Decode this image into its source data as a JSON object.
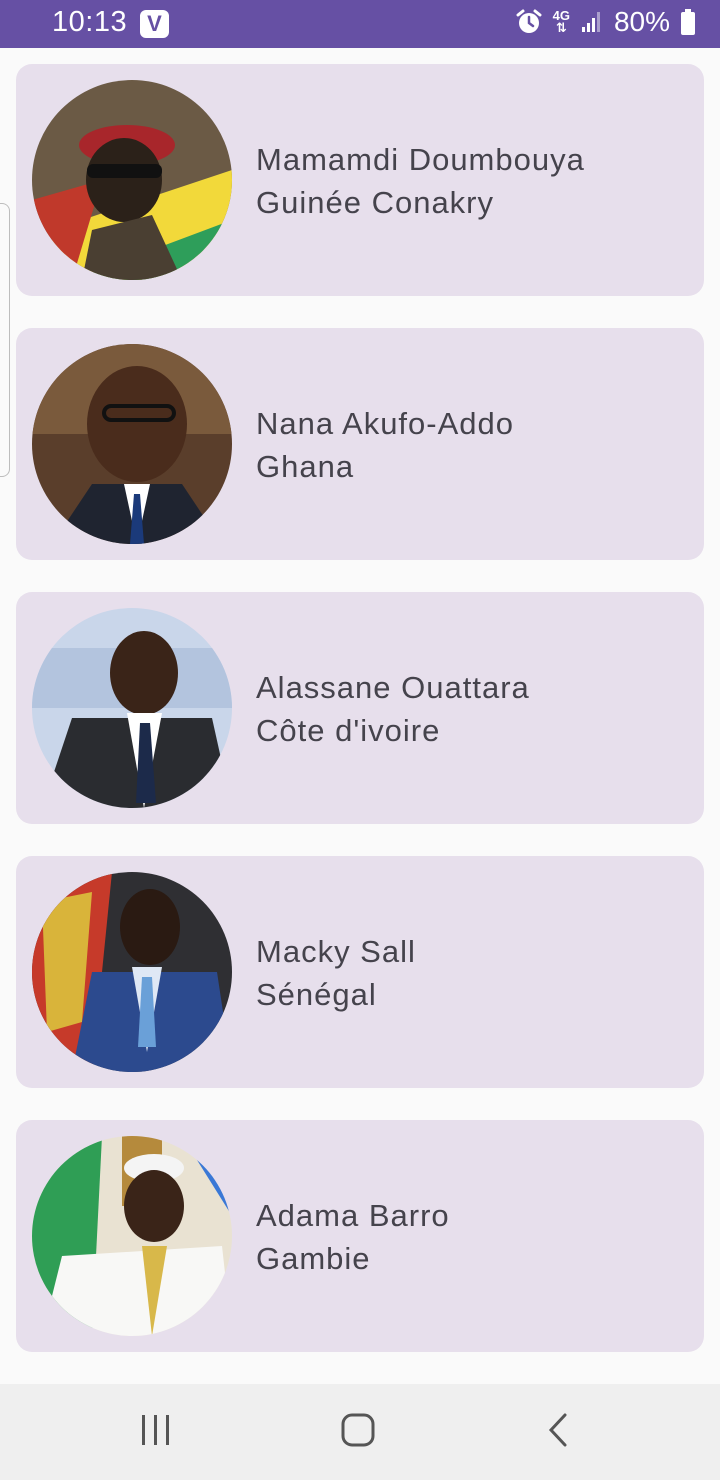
{
  "status_bar": {
    "time": "10:13",
    "app_icon": "V",
    "network": "4G",
    "battery": "80%",
    "icons": [
      "alarm-icon",
      "network-4g-icon",
      "signal-icon",
      "battery-icon"
    ]
  },
  "leaders": [
    {
      "name": "Mamamdi Doumbouya",
      "country": "Guinée Conakry"
    },
    {
      "name": "Nana Akufo-Addo",
      "country": "Ghana"
    },
    {
      "name": "Alassane Ouattara",
      "country": "Côte d'ivoire"
    },
    {
      "name": "Macky Sall",
      "country": "Sénégal"
    },
    {
      "name": "Adama Barro",
      "country": "Gambie"
    }
  ],
  "nav_bar": {
    "icons": [
      "recent-apps-icon",
      "home-icon",
      "back-icon"
    ]
  },
  "colors": {
    "status_bar": "#6650a4",
    "card_background": "#e7dfec",
    "text": "#45434c",
    "page_background": "#fafafa"
  }
}
